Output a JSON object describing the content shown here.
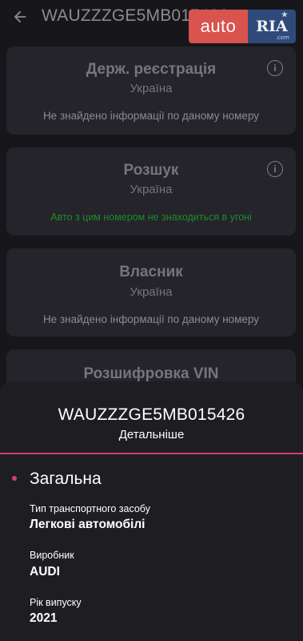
{
  "header": {
    "title": "WAUZZZGE5MB015426",
    "back_icon": "arrow-left-icon"
  },
  "logo": {
    "auto_text": "auto",
    "ria_text": "RIA",
    "ria_sub": ".com",
    "colors": {
      "auto_bg": "#d9534f",
      "ria_bg": "#2f4a7a"
    }
  },
  "cards": [
    {
      "title": "Держ. реєстрація",
      "subtitle": "Україна",
      "status": "Не знайдено інформації по даному номеру",
      "has_info": true
    },
    {
      "title": "Розшук",
      "subtitle": "Україна",
      "status": "Авто з цим номером не знаходиться в угоні",
      "has_info": true,
      "status_color": "#1f8a2a"
    },
    {
      "title": "Власник",
      "subtitle": "Україна",
      "status": "Не знайдено інформації по даному номеру",
      "has_info": false
    },
    {
      "title": "Розшифровка VIN",
      "has_info": false
    }
  ],
  "sheet": {
    "vin": "WAUZZZGE5MB015426",
    "more_label": "Детальніше",
    "accent": "#d0406a",
    "section_title": "Загальна",
    "fields": [
      {
        "label": "Тип транспортного засобу",
        "value": "Легкові автомобілі"
      },
      {
        "label": "Виробник",
        "value": "AUDI"
      },
      {
        "label": "Рік випуску",
        "value": "2021"
      }
    ]
  }
}
